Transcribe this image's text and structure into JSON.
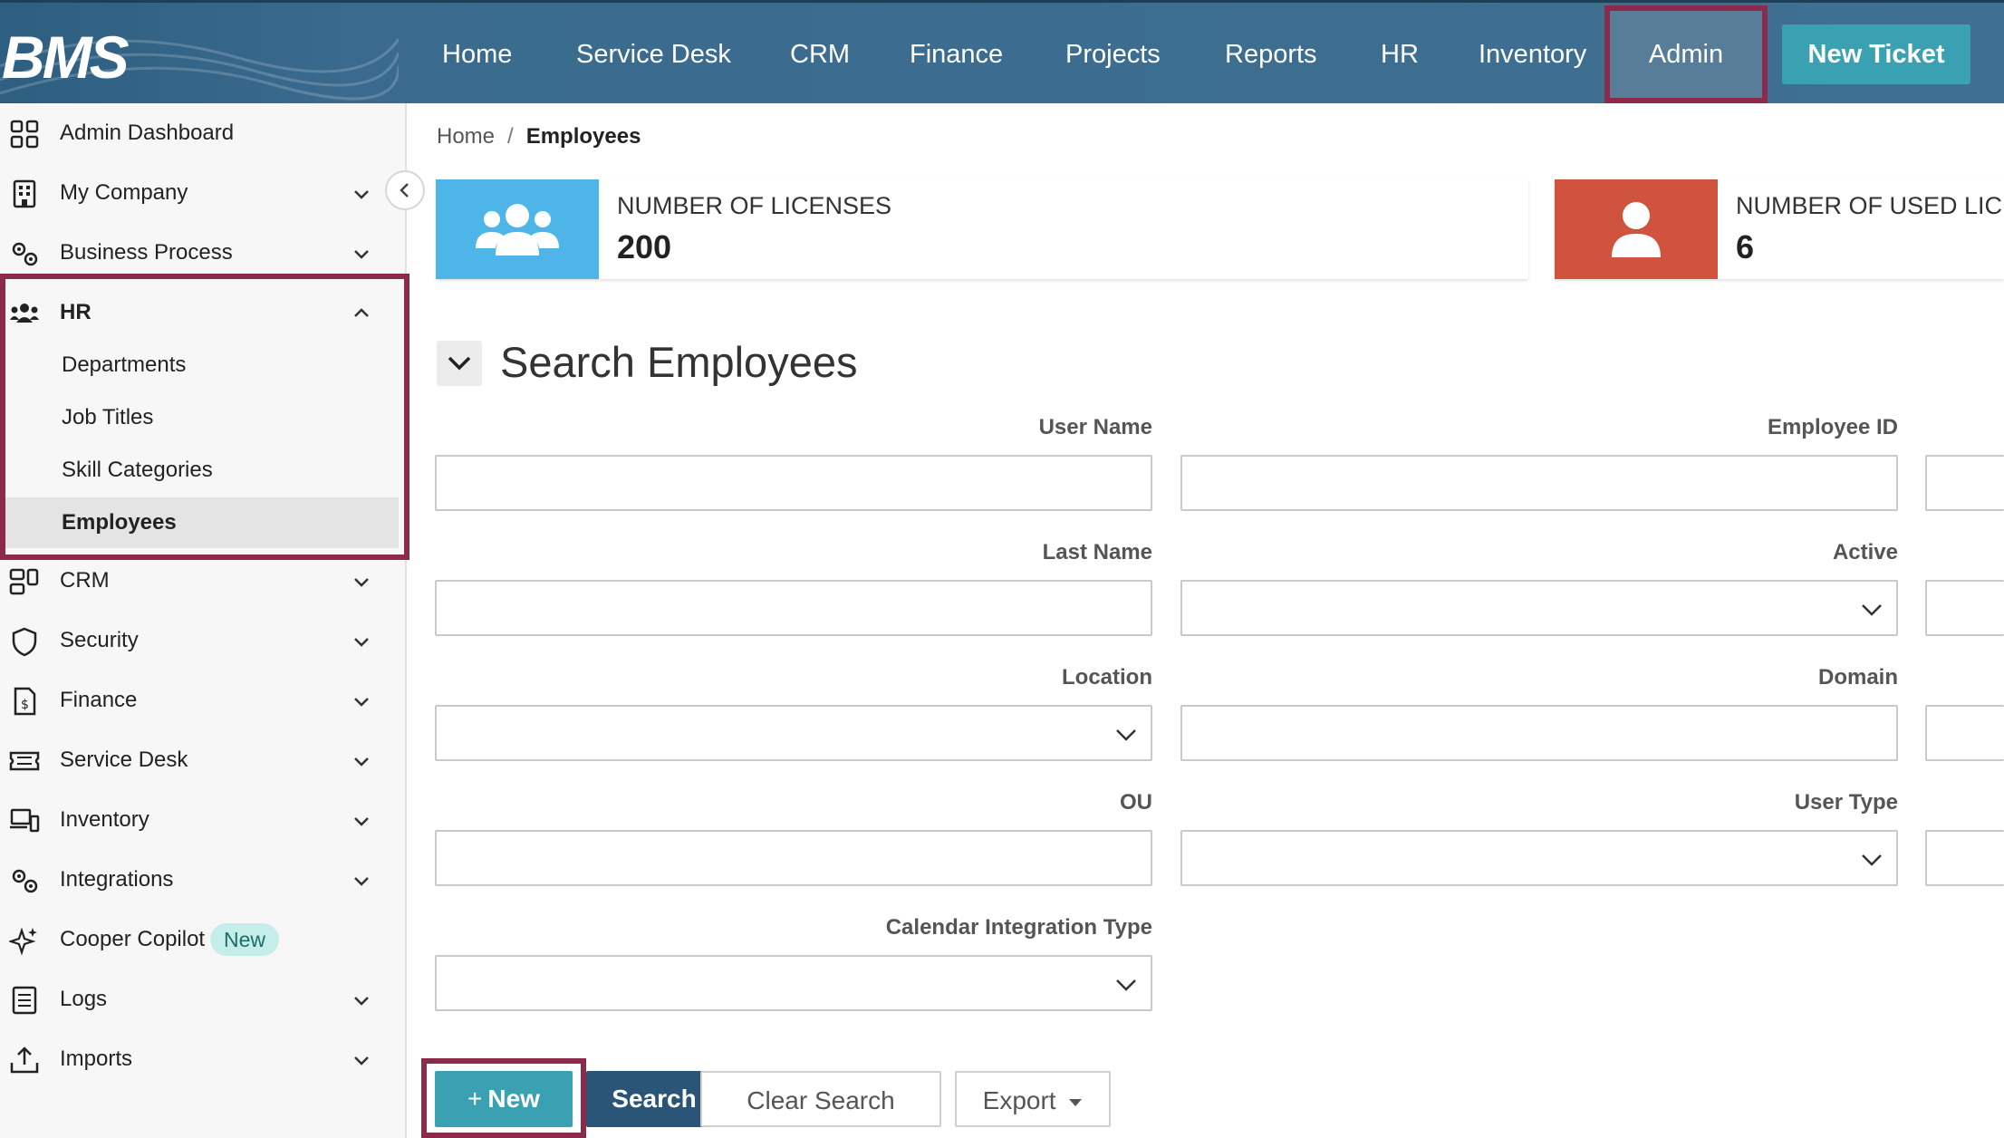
{
  "app": {
    "logo_text": "BMS"
  },
  "topnav": {
    "items": [
      "Home",
      "Service Desk",
      "CRM",
      "Finance",
      "Projects",
      "Reports",
      "HR",
      "Inventory"
    ],
    "admin_label": "Admin",
    "new_ticket_label": "New Ticket"
  },
  "sidebar": {
    "admin_dashboard": "Admin Dashboard",
    "my_company": "My Company",
    "business_process": "Business Process",
    "hr": "HR",
    "hr_children": [
      "Departments",
      "Job Titles",
      "Skill Categories",
      "Employees"
    ],
    "crm": "CRM",
    "security": "Security",
    "finance": "Finance",
    "service_desk": "Service Desk",
    "inventory": "Inventory",
    "integrations": "Integrations",
    "cooper_copilot": "Cooper Copilot",
    "new_badge": "New",
    "logs": "Logs",
    "imports": "Imports"
  },
  "breadcrumb": {
    "home": "Home",
    "separator": "/",
    "current": "Employees"
  },
  "cards": {
    "licenses": {
      "title": "NUMBER OF LICENSES",
      "value": "200"
    },
    "used": {
      "title": "NUMBER OF USED LICE",
      "value": "6"
    }
  },
  "search": {
    "title": "Search Employees",
    "labels": {
      "user_name": "User Name",
      "employee_id": "Employee ID",
      "last_name": "Last Name",
      "active": "Active",
      "location": "Location",
      "domain": "Domain",
      "ou": "OU",
      "user_type": "User Type",
      "calendar_integration_type": "Calendar Integration Type"
    }
  },
  "buttons": {
    "new": "New",
    "search": "Search",
    "clear_search": "Clear Search",
    "export": "Export"
  },
  "colors": {
    "topbar": "#3f7092",
    "accent_teal": "#3aa1b3",
    "dark_blue": "#2a5577",
    "highlight": "#8c2a4c",
    "licenses_card": "#4db5e7",
    "used_card": "#d0533d"
  }
}
